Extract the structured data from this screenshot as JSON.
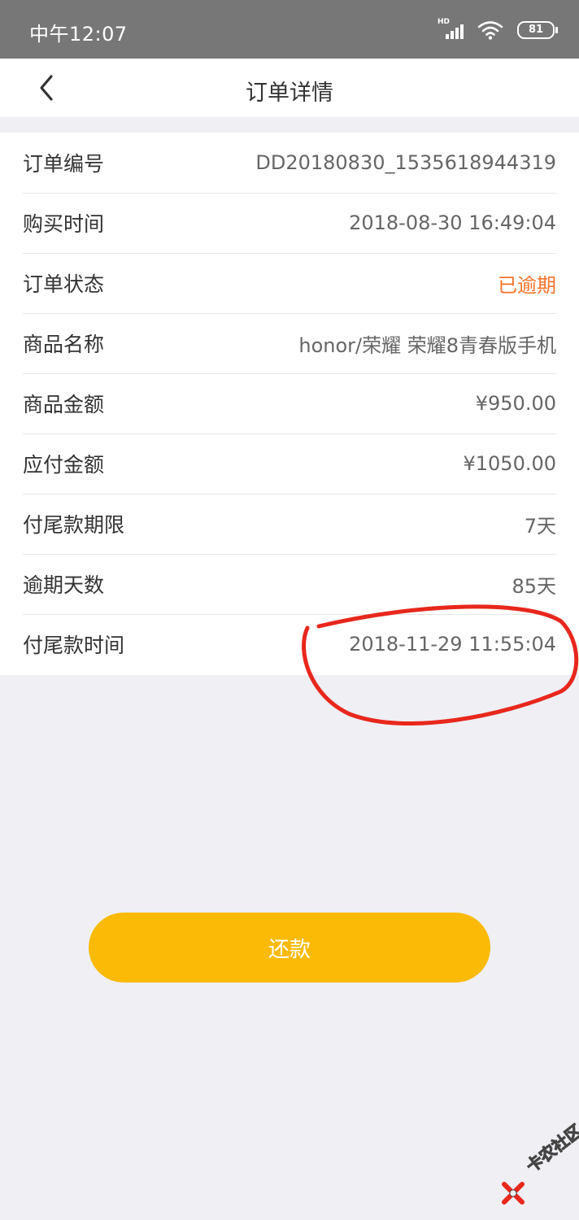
{
  "status_bar": {
    "time": "中午12:07",
    "network_label": "HD",
    "battery": "81"
  },
  "header": {
    "title": "订单详情",
    "back_icon": "chevron-left-icon"
  },
  "order_details": [
    {
      "label": "订单编号",
      "value": "DD20180830_1535618944319"
    },
    {
      "label": "购买时间",
      "value": "2018-08-30 16:49:04"
    },
    {
      "label": "订单状态",
      "value": "已逾期",
      "value_color": "#f5732a"
    },
    {
      "label": "商品名称",
      "value": "honor/荣耀 荣耀8青春版手机"
    },
    {
      "label": "商品金额",
      "value": "¥950.00"
    },
    {
      "label": "应付金额",
      "value": "¥1050.00"
    },
    {
      "label": "付尾款期限",
      "value": "7天"
    },
    {
      "label": "逾期天数",
      "value": "85天"
    },
    {
      "label": "付尾款时间",
      "value": "2018-11-29 11:55:04"
    }
  ],
  "actions": {
    "repay_label": "还款",
    "repay_color": "#fbba06"
  },
  "watermark": {
    "text": "卡农社区"
  },
  "colors": {
    "status_bar": "#777777",
    "background": "#efeff4",
    "annotation": "#e8271c"
  }
}
